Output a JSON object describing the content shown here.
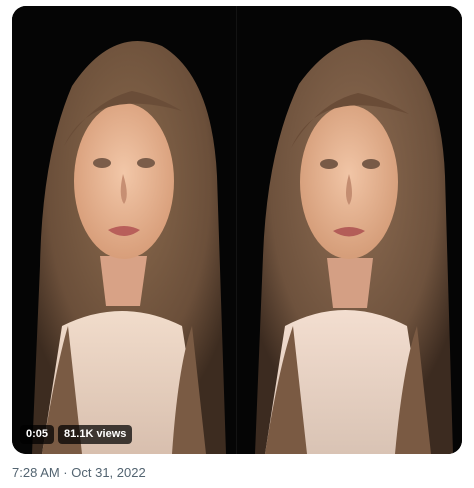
{
  "tweet": {
    "media": {
      "duration": "0:05",
      "views": "81.1K views"
    },
    "timestamp": "7:28 AM · Oct 31, 2022"
  }
}
